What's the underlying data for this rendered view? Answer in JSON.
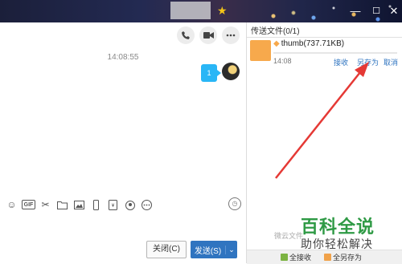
{
  "titlebar": {
    "star": "★",
    "min": "—",
    "max": "☐",
    "close": "✕"
  },
  "chat": {
    "timestamp": "14:08:55",
    "bubble_text": "1",
    "close_label": "关闭(C)",
    "send_label": "发送(S)",
    "send_chevron": "⌄"
  },
  "transfer": {
    "tab_label": "传送文件(0/1)",
    "file_name": "thumb(737.71KB)",
    "file_time": "14:08",
    "progress": 0,
    "receive_label": "接收",
    "save_as_label": "另存为",
    "cancel_label": "取消",
    "faint_text": "微云文件",
    "receive_all_label": "全接收",
    "save_all_label": "全另存为"
  },
  "brand": {
    "title": "百科全说",
    "subtitle": "助你轻松解决"
  },
  "colors": {
    "accent": "#2f74c0",
    "arrow": "#e53935",
    "brand": "#2f9a45",
    "folder": "#f7a94c"
  }
}
